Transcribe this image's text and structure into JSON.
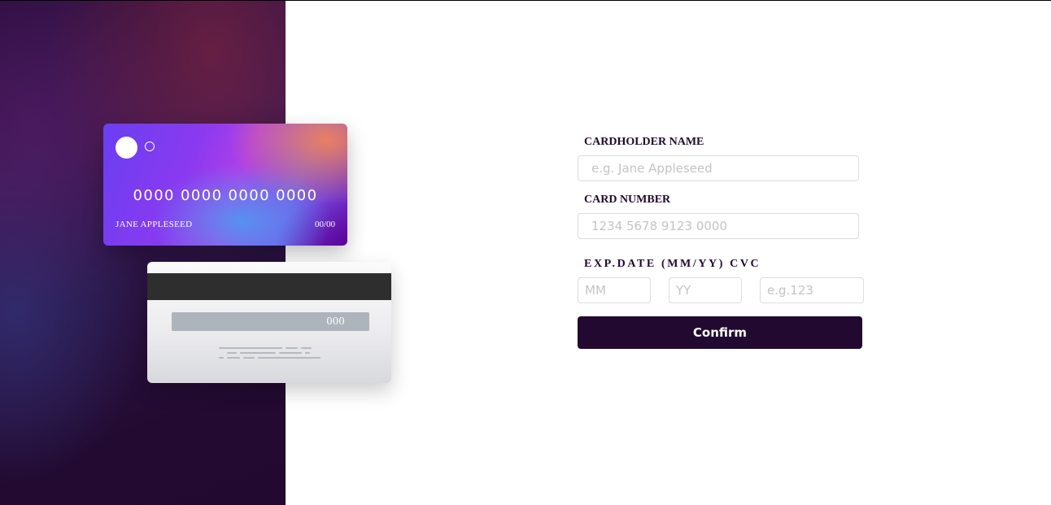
{
  "card_front": {
    "number": "0000 0000 0000 0000",
    "name": "JANE APPLESEED",
    "expiry": "00/00"
  },
  "card_back": {
    "cvc": "000"
  },
  "form": {
    "cardholder_label": "CARDHOLDER NAME",
    "cardholder_placeholder": "e.g. Jane Appleseed",
    "number_label": "CARD NUMBER",
    "number_placeholder": "1234 5678 9123 0000",
    "exp_label": "EXP.DATE (MM/YY) CVC",
    "month_placeholder": "MM",
    "year_placeholder": "YY",
    "cvc_placeholder": "e.g.123",
    "confirm_label": "Confirm"
  },
  "colors": {
    "dark_violet": "#21092f",
    "input_border": "#dedddf",
    "placeholder": "#c4c4c9"
  }
}
